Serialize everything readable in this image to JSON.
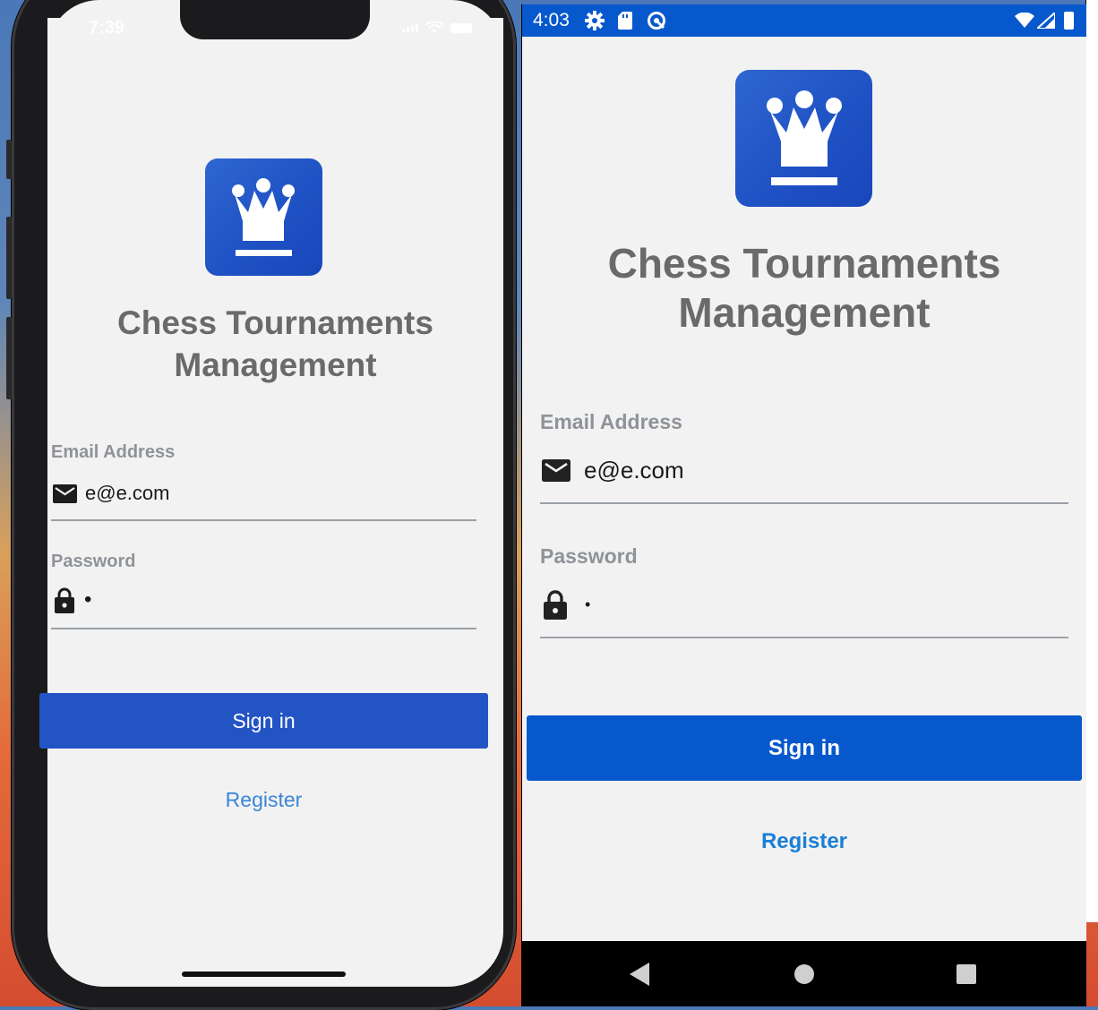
{
  "ios": {
    "status_time": "7:39",
    "app_title_line1": "Chess Tournaments",
    "app_title_line2": "Management",
    "email_label": "Email Address",
    "email_value": "e@e.com",
    "password_label": "Password",
    "password_value": "•",
    "sign_in_label": "Sign in",
    "register_label": "Register",
    "colors": {
      "button": "#2354c4",
      "link": "#3a86d6",
      "logo": "#1f52c4"
    }
  },
  "android": {
    "status_time": "4:03",
    "app_title_line1": "Chess Tournaments",
    "app_title_line2": "Management",
    "email_label": "Email Address",
    "email_value": "e@e.com",
    "password_label": "Password",
    "password_value": "•",
    "sign_in_label": "Sign in",
    "register_label": "Register",
    "colors": {
      "status_bar": "#0758cc",
      "button": "#0758cc",
      "link": "#1a7fd6"
    }
  },
  "icons": [
    "crown-logo-icon",
    "mail-icon",
    "lock-icon",
    "wifi-icon",
    "battery-icon",
    "settings-icon",
    "sd-card-icon",
    "sync-icon",
    "signal-icon",
    "back-icon",
    "home-icon",
    "recents-icon"
  ]
}
